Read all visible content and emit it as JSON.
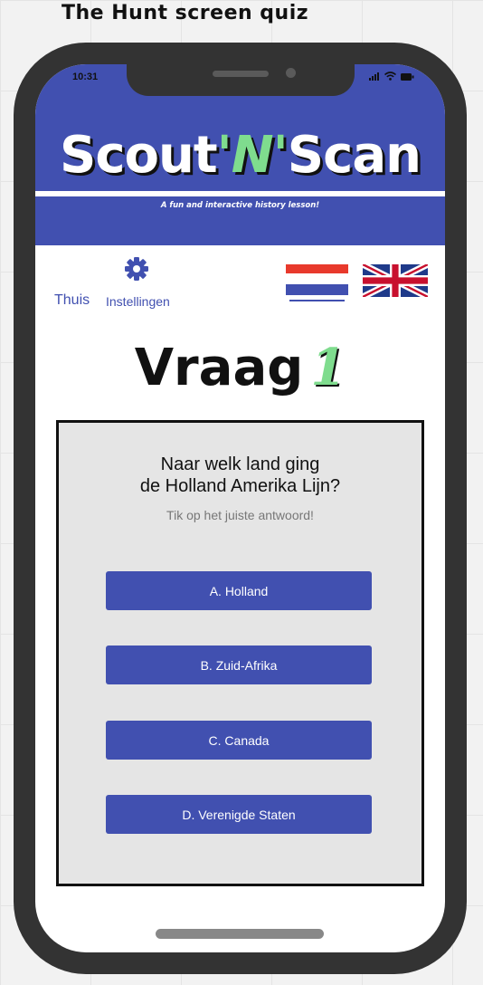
{
  "canvas_title": "The Hunt screen quiz",
  "status_bar": {
    "time": "10:31",
    "icons": [
      "signal-icon",
      "wifi-icon",
      "battery-icon"
    ]
  },
  "header": {
    "logo_left": "Scout",
    "logo_mid": "'N'",
    "logo_right": "Scan",
    "tagline": "A fun and interactive history lesson!"
  },
  "nav": {
    "home_label": "Thuis",
    "settings_label": "Instellingen",
    "settings_icon": "gear-icon",
    "languages": [
      "flag-netherlands-icon",
      "flag-uk-icon"
    ]
  },
  "question": {
    "heading": "Vraag",
    "number": "1",
    "line1": "Naar welk land ging",
    "line2": "de Holland Amerika Lijn?",
    "hint": "Tik op het juiste antwoord!"
  },
  "answers": [
    "A. Holland",
    "B. Zuid-Afrika",
    "C. Canada",
    "D. Verenigde Staten"
  ],
  "colors": {
    "primary": "#4150b0",
    "accent_green": "#7fdc8e",
    "quiz_bg": "#e5e5e5",
    "phone_frame": "#333333"
  }
}
